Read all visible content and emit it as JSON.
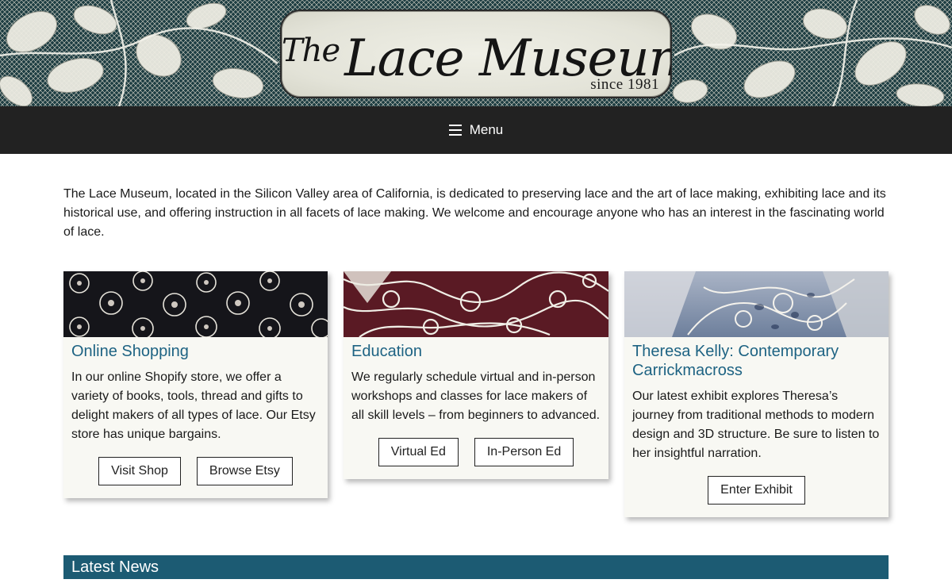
{
  "header": {
    "logo_the": "The",
    "logo_name": "Lace Museum",
    "logo_since": "since 1981"
  },
  "nav": {
    "menu_label": "Menu"
  },
  "intro": {
    "text": "The Lace Museum, located in the Silicon Valley area of California, is dedicated to preserving lace and the art of lace making, exhibiting lace and its historical use, and offering instruction in all facets of lace making. We welcome and encourage anyone who has an interest in the fascinating world of lace."
  },
  "cards": [
    {
      "title": "Online Shopping",
      "text": "In our online Shopify store, we offer a variety of books, tools, thread and gifts to delight makers of all types of lace. Our Etsy store has unique bargains.",
      "buttons": [
        "Visit Shop",
        "Browse Etsy"
      ]
    },
    {
      "title": "Education",
      "text": "We regularly schedule virtual and in-person workshops and classes for lace makers of all skill levels – from beginners to advanced.",
      "buttons": [
        "Virtual Ed",
        "In-Person Ed"
      ]
    },
    {
      "title": "Theresa Kelly: Contemporary Carrickmacross",
      "text": "Our latest exhibit explores Theresa’s journey from traditional methods to modern design and 3D structure. Be sure to listen to her insightful narration.",
      "buttons": [
        "Enter Exhibit"
      ]
    }
  ],
  "news": {
    "heading": "Latest News"
  },
  "colors": {
    "menu_bg": "#222222",
    "card_title": "#1e6383",
    "news_bar": "#1c5b73",
    "card_bg": "#f8f8f3"
  }
}
